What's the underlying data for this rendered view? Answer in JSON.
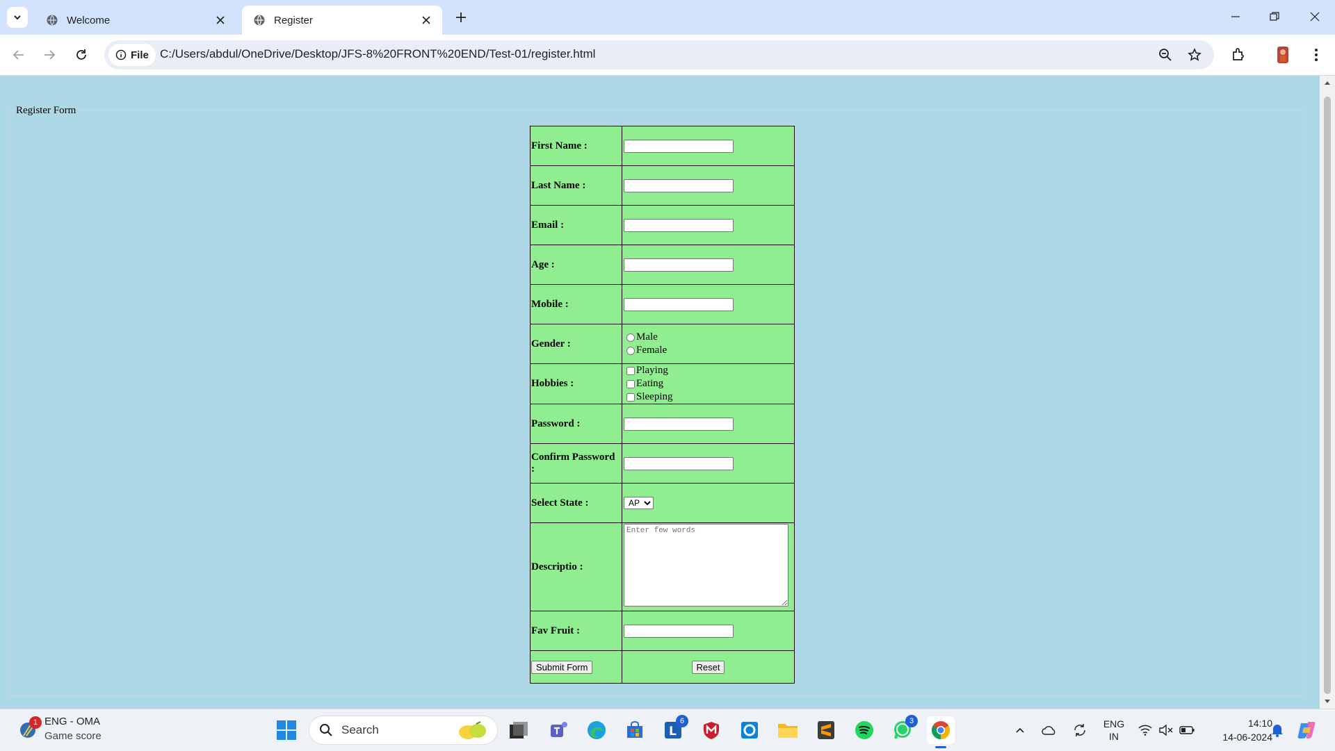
{
  "browser": {
    "tabs": [
      {
        "title": "Welcome",
        "active": false
      },
      {
        "title": "Register",
        "active": true
      }
    ],
    "site_chip_label": "File",
    "url": "C:/Users/abdul/OneDrive/Desktop/JFS-8%20FRONT%20END/Test-01/register.html"
  },
  "page": {
    "legend": "Register Form",
    "fields": {
      "first_name": "First Name :",
      "last_name": "Last Name :",
      "email": "Email :",
      "age": "Age :",
      "mobile": "Mobile :",
      "gender": "Gender :",
      "hobbies": "Hobbies :",
      "password": "Password :",
      "confirm_password": "Confirm Password :",
      "state": "Select State :",
      "description": "Descriptio :",
      "fav_fruit": "Fav Fruit :"
    },
    "gender_options": [
      "Male",
      "Female"
    ],
    "hobby_options": [
      "Playing",
      "Eating",
      "Sleeping"
    ],
    "state_selected": "AP",
    "description_placeholder": "Enter few words",
    "submit_label": "Submit Form",
    "reset_label": "Reset"
  },
  "taskbar": {
    "widget_title": "ENG - OMA",
    "widget_subtitle": "Game score",
    "widget_badge": "1",
    "search_label": "Search",
    "outlook_badge": "6",
    "whatsapp_badge": "3",
    "lang_top": "ENG",
    "lang_bottom": "IN",
    "time": "14:10",
    "date": "14-06-2024"
  },
  "colors": {
    "page_bg": "#add8e6",
    "form_bg": "#90ee90",
    "tabbar_bg": "#d3e3fd"
  }
}
